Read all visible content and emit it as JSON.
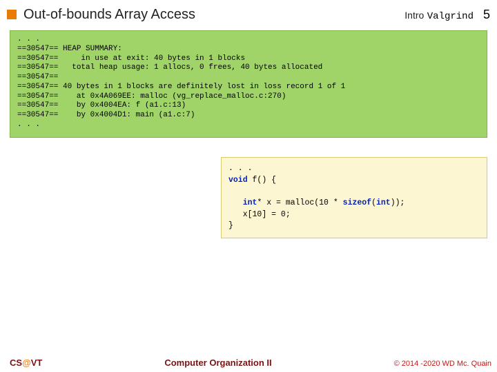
{
  "header": {
    "title": "Out-of-bounds Array Access",
    "topic_label": "Intro",
    "topic_code": "Valgrind",
    "page_number": "5"
  },
  "valgrind_output": ". . .\n==30547== HEAP SUMMARY:\n==30547==     in use at exit: 40 bytes in 1 blocks\n==30547==   total heap usage: 1 allocs, 0 frees, 40 bytes allocated\n==30547==\n==30547== 40 bytes in 1 blocks are definitely lost in loss record 1 of 1\n==30547==    at 0x4A069EE: malloc (vg_replace_malloc.c:270)\n==30547==    by 0x4004EA: f (a1.c:13)\n==30547==    by 0x4004D1: main (a1.c:7)\n. . .",
  "source_preamble": ". . .",
  "source": {
    "kw_void": "void",
    "fn_decl_rest": " f() {",
    "kw_int": "int",
    "decl_rest": "* x = malloc(10 * ",
    "kw_sizeof": "sizeof",
    "sizeof_rest": "(",
    "kw_int2": "int",
    "sizeof_close": "));",
    "stmt2": "x[10] = 0;",
    "close_brace": "}"
  },
  "footer": {
    "course_prefix": "CS",
    "course_at": "@",
    "course_suffix": "VT",
    "center": "Computer Organization II",
    "copyright": "© 2014 -2020 WD Mc. Quain"
  }
}
